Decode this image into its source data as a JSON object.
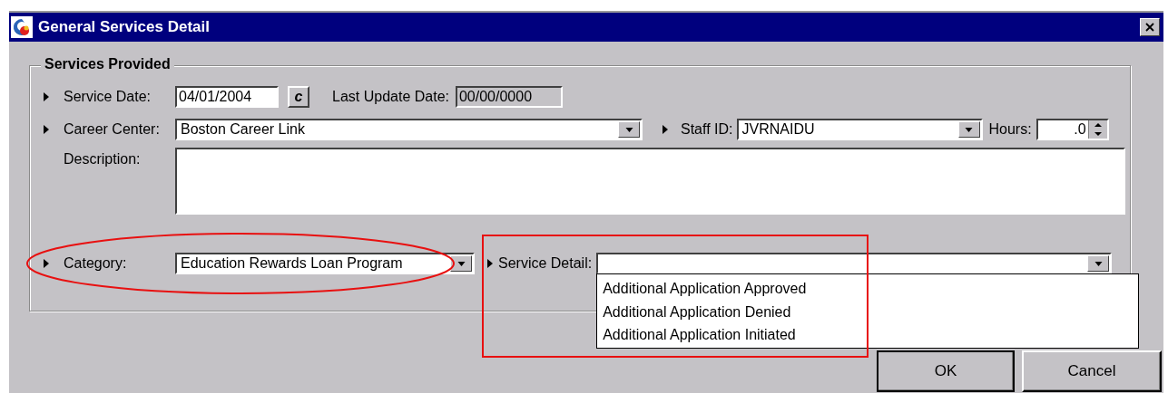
{
  "window": {
    "title": "General Services Detail"
  },
  "group": {
    "title": "Services Provided"
  },
  "service_date": {
    "label": "Service Date:",
    "value": "04/01/2004",
    "button": "c"
  },
  "last_update_date": {
    "label": "Last Update Date:",
    "value": "00/00/0000",
    "disabled": true
  },
  "career_center": {
    "label": "Career Center:",
    "value": "Boston Career Link"
  },
  "staff_id": {
    "label": "Staff ID:",
    "value": "JVRNAIDU"
  },
  "hours": {
    "label": "Hours:",
    "value": ".0"
  },
  "description": {
    "label": "Description:"
  },
  "category": {
    "label": "Category:",
    "value": "Education Rewards Loan Program"
  },
  "service_detail": {
    "label": "Service Detail:",
    "expanded": true,
    "options": [
      "Additional Application Approved",
      "Additional Application Denied",
      "Additional Application Initiated"
    ]
  },
  "buttons": [
    {
      "label": "OK"
    },
    {
      "label": "Cancel"
    }
  ],
  "annotations": [
    {
      "kind": "ellipse"
    },
    {
      "kind": "rectangle"
    }
  ]
}
